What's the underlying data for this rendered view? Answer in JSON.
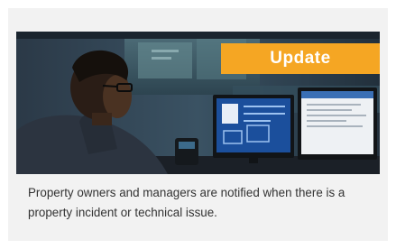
{
  "card": {
    "badge_label": "Update",
    "description": "Property owners and managers are notified when there is a property incident or technical issue."
  },
  "image": {
    "subject": "photo",
    "accent_color": "#f5a623"
  }
}
